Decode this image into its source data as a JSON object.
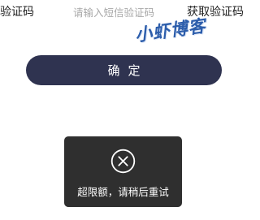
{
  "verification": {
    "label": "验证码",
    "input_placeholder": "请输入短信验证码",
    "input_value": "",
    "get_code_label": "获取验证码"
  },
  "watermark": {
    "text": "小虾博客"
  },
  "confirm_button": {
    "label": "确定"
  },
  "toast": {
    "icon": "close-circle-icon",
    "message": "超限额，请稍后重试"
  },
  "colors": {
    "button_bg": "#2f3350",
    "toast_bg": "#2f2f2f",
    "watermark": "#2c5dab",
    "placeholder": "#a8a8a8"
  }
}
